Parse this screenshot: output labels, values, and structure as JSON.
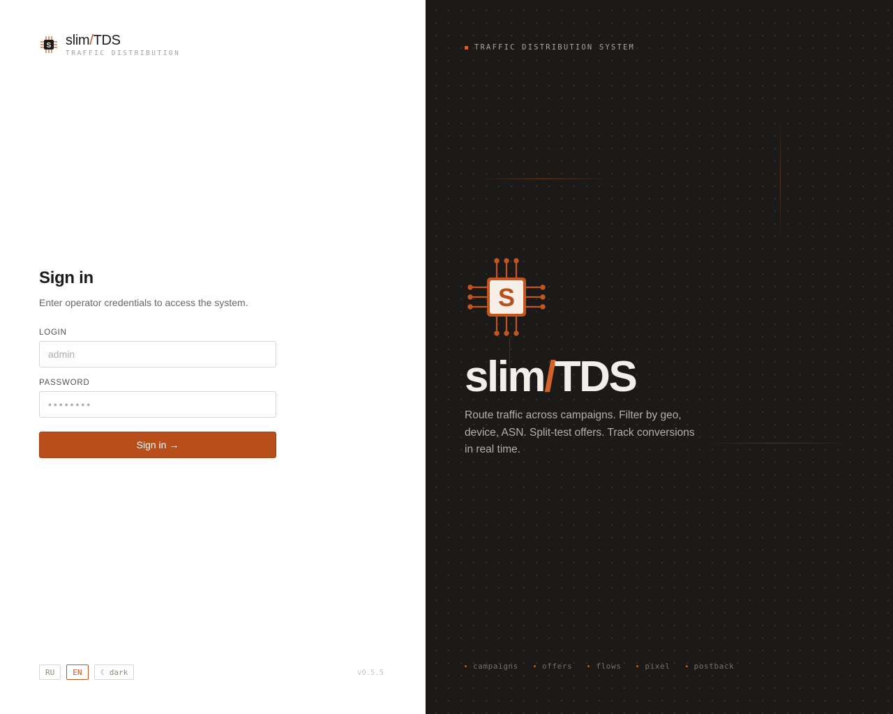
{
  "brand": {
    "name_left": "slim",
    "name_slash": "/",
    "name_right": "TDS",
    "subtitle": "TRAFFIC DISTRIBUTION",
    "chip_letter": "S"
  },
  "signin": {
    "title": "Sign in",
    "description": "Enter operator credentials to access the system.",
    "login_label": "LOGIN",
    "login_placeholder": "admin",
    "password_label": "PASSWORD",
    "password_placeholder": "••••••••",
    "submit_label": "Sign in →"
  },
  "footer": {
    "lang_ru": "RU",
    "lang_en": "EN",
    "theme_toggle": "☾ dark",
    "version": "v0.5.5"
  },
  "hero": {
    "tagline": "TRAFFIC DISTRIBUTION SYSTEM",
    "title_left": "slim",
    "title_slash": "/",
    "title_right": "TDS",
    "chip_letter": "S",
    "description": "Route traffic across campaigns. Filter by geo, device, ASN. Split-test offers. Track conversions in real time.",
    "modules": [
      "campaigns",
      "offers",
      "flows",
      "pixel",
      "postback"
    ]
  },
  "colors": {
    "accent": "#b84f1b",
    "accent_light": "#d2622a",
    "dark_bg": "#1c1a18"
  }
}
